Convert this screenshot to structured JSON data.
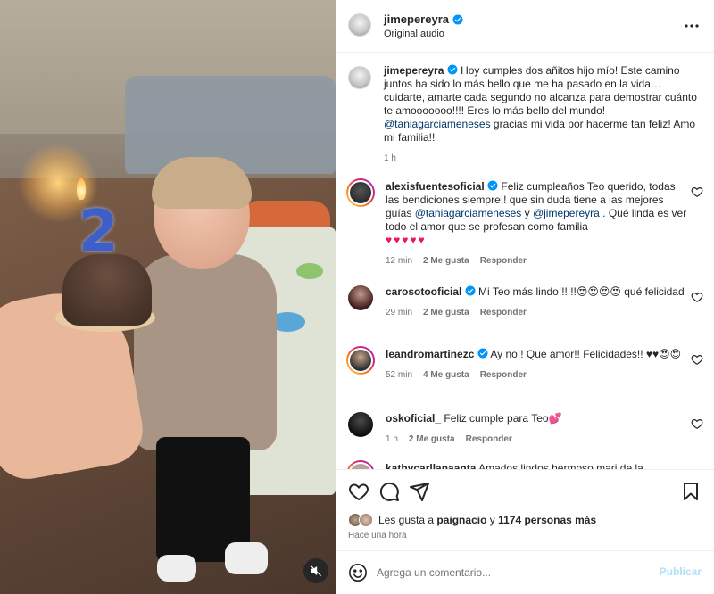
{
  "post": {
    "username": "jimepereyra",
    "audio": "Original audio",
    "caption_user": "jimepereyra",
    "caption_text": " Hoy cumples dos añitos hijo mío! Este camino juntos ha sido lo más bello que me ha pasado en la vida… cuidarte, amarte cada segundo no alcanza para demostrar cuánto te amooooooo!!!! Eres lo más bello del mundo! ",
    "caption_mention": "@taniagarciameneses",
    "caption_tail": " gracias mi vida por hacerme tan feliz! Amo mi familia!!",
    "caption_time": "1 h"
  },
  "comments": [
    {
      "user": "alexisfuentesoficial",
      "verified": true,
      "text_a": " Feliz cumpleaños Teo querido, todas las bendiciones siempre!! que sin duda tiene a las mejores guías ",
      "mention1": "@taniagarciameneses",
      "text_b": " y ",
      "mention2": "@jimepereyra",
      "text_c": " . Qué linda es ver todo el amor que se profesan como familia",
      "emoji": "♥♥♥♥♥",
      "time": "12 min",
      "likes": "2 Me gusta",
      "reply": "Responder"
    },
    {
      "user": "carosotooficial",
      "verified": true,
      "text": " Mi Teo más lindo!!!!!!😍😍😍😍 qué felicidad",
      "time": "29 min",
      "likes": "2 Me gusta",
      "reply": "Responder"
    },
    {
      "user": "leandromartinezc",
      "verified": true,
      "text": " Ay no!! Que amor!! Felicidades!! ♥♥😍😍",
      "time": "52 min",
      "likes": "4 Me gusta",
      "reply": "Responder"
    },
    {
      "user": "oskoficial_",
      "verified": false,
      "text": " Feliz cumple para Teo💕",
      "time": "1 h",
      "likes": "2 Me gusta",
      "reply": "Responder"
    },
    {
      "user": "kathycarllanaanta",
      "verified": false,
      "text": " Amados lindos hermoso mari de la",
      "time": "",
      "likes": "",
      "reply": ""
    }
  ],
  "likes": {
    "prefix": "Les gusta a ",
    "user": "paignacio",
    "mid": " y ",
    "others": "1174 personas más"
  },
  "timestamp": "Hace una hora",
  "compose": {
    "placeholder": "Agrega un comentario...",
    "post_label": "Publicar"
  },
  "media": {
    "candle_number": "2"
  },
  "colors": {
    "verified": "#0095f6",
    "mention": "#00376b",
    "heart": "#e8185a",
    "post_button": "#b2dffc"
  },
  "icons": [
    "more-options-icon",
    "verified-icon",
    "like-icon",
    "comment-icon",
    "share-icon",
    "save-icon",
    "emoji-icon",
    "mute-icon"
  ]
}
